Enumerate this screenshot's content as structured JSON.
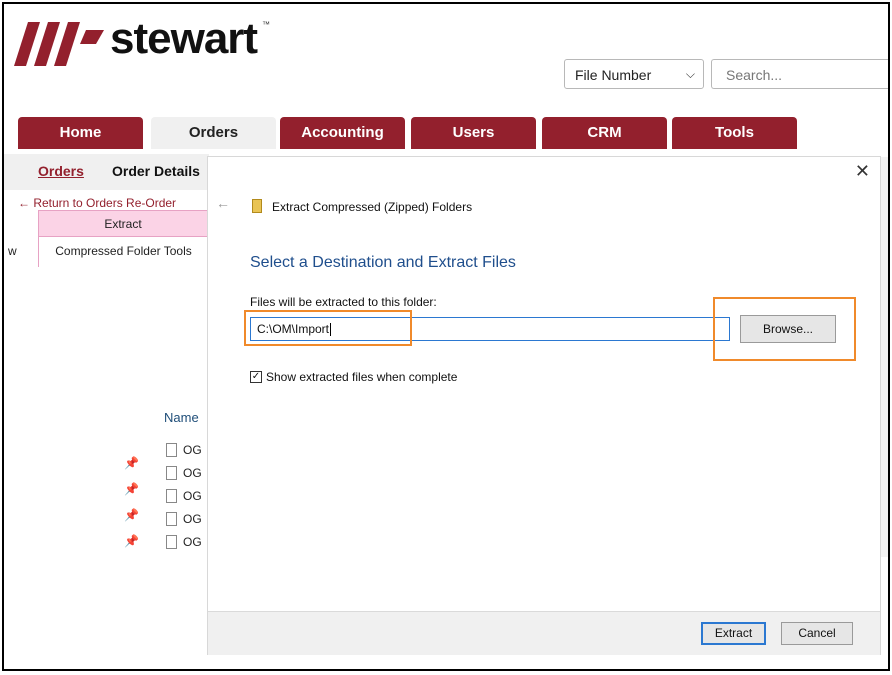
{
  "brand": {
    "name": "stewart",
    "trademark": "™"
  },
  "search": {
    "type_value": "File Number",
    "placeholder": "Search..."
  },
  "tabs": [
    {
      "label": "Home",
      "active": false
    },
    {
      "label": "Orders",
      "active": true
    },
    {
      "label": "Accounting",
      "active": false
    },
    {
      "label": "Users",
      "active": false
    },
    {
      "label": "CRM",
      "active": false
    },
    {
      "label": "Tools",
      "active": false
    }
  ],
  "subnav": {
    "orders": "Orders",
    "order_details": "Order Details"
  },
  "ribbon": {
    "links": "← Return to Orders    Re-Order"
  },
  "explorer": {
    "extract_tab": "Extract",
    "tools_tab": "Compressed Folder Tools",
    "left_fragment": "w",
    "name_header": "Name",
    "files": [
      "OG",
      "OG",
      "OG",
      "OG",
      "OG"
    ]
  },
  "dialog": {
    "title": "Extract Compressed (Zipped) Folders",
    "heading": "Select a Destination and Extract Files",
    "dest_label": "Files will be extracted to this folder:",
    "dest_value": "C:\\OM\\Import",
    "browse_label": "Browse...",
    "show_files_label": "Show extracted files when complete",
    "show_files_checked": true,
    "extract_label": "Extract",
    "cancel_label": "Cancel"
  },
  "colors": {
    "brand": "#93202d",
    "highlight": "#f08a2b",
    "heading": "#1f4e8c"
  }
}
